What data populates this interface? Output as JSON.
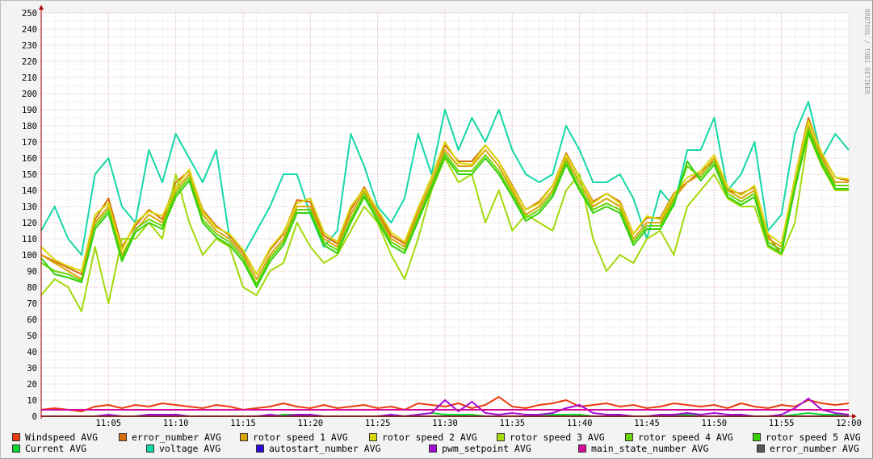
{
  "chart_data": {
    "type": "line",
    "watermark": "RRDTOOL / TOBI OETIKER",
    "ylim": [
      0,
      250
    ],
    "yticks": [
      0,
      10,
      20,
      30,
      40,
      50,
      60,
      70,
      80,
      90,
      100,
      110,
      120,
      130,
      140,
      150,
      160,
      170,
      180,
      190,
      200,
      210,
      220,
      230,
      240,
      250
    ],
    "x_minutes_range": [
      0,
      60
    ],
    "xticks": [
      {
        "m": 5,
        "label": "11:05"
      },
      {
        "m": 10,
        "label": "11:10"
      },
      {
        "m": 15,
        "label": "11:15"
      },
      {
        "m": 20,
        "label": "11:20"
      },
      {
        "m": 25,
        "label": "11:25"
      },
      {
        "m": 30,
        "label": "11:30"
      },
      {
        "m": 35,
        "label": "11:35"
      },
      {
        "m": 40,
        "label": "11:40"
      },
      {
        "m": 45,
        "label": "11:45"
      },
      {
        "m": 50,
        "label": "11:50"
      },
      {
        "m": 55,
        "label": "11:55"
      },
      {
        "m": 60,
        "label": "12:00"
      }
    ],
    "series": [
      {
        "name": "Windspeed AVG",
        "color": "#ea3c0c",
        "values": [
          4,
          5,
          4,
          3,
          6,
          7,
          5,
          7,
          6,
          8,
          7,
          6,
          5,
          7,
          6,
          4,
          5,
          6,
          8,
          6,
          5,
          7,
          5,
          6,
          7,
          5,
          6,
          4,
          8,
          7,
          6,
          8,
          5,
          7,
          12,
          6,
          5,
          7,
          8,
          10,
          6,
          7,
          8,
          6,
          7,
          5,
          6,
          8,
          7,
          6,
          7,
          5,
          8,
          6,
          5,
          7,
          6,
          10,
          8,
          7,
          8
        ]
      },
      {
        "name": "error_number AVG",
        "color": "#d76c0a",
        "values": [
          100,
          96,
          92,
          88,
          122,
          135,
          105,
          118,
          128,
          122,
          145,
          152,
          128,
          118,
          112,
          102,
          88,
          103,
          113,
          134,
          133,
          112,
          107,
          128,
          142,
          127,
          112,
          107,
          128,
          148,
          168,
          158,
          158,
          168,
          158,
          143,
          128,
          133,
          143,
          163,
          148,
          133,
          138,
          133,
          113,
          123,
          123,
          138,
          145,
          152,
          158,
          140,
          138,
          142,
          112,
          100,
          148,
          185,
          162,
          148,
          146
        ]
      },
      {
        "name": "rotor speed 1 AVG",
        "color": "#daa50a",
        "values": [
          100,
          95,
          90,
          85,
          120,
          130,
          100,
          115,
          125,
          120,
          140,
          150,
          125,
          115,
          110,
          100,
          85,
          100,
          110,
          130,
          130,
          110,
          105,
          125,
          140,
          125,
          110,
          105,
          125,
          145,
          165,
          155,
          155,
          165,
          155,
          140,
          125,
          130,
          140,
          160,
          145,
          130,
          135,
          130,
          110,
          120,
          120,
          135,
          145,
          150,
          160,
          140,
          135,
          140,
          110,
          105,
          145,
          180,
          160,
          145,
          145
        ]
      },
      {
        "name": "rotor speed 2 AVG",
        "color": "#d8d80a",
        "values": [
          105,
          97,
          93,
          90,
          125,
          132,
          103,
          120,
          127,
          124,
          142,
          153,
          127,
          117,
          113,
          103,
          88,
          104,
          114,
          132,
          135,
          114,
          108,
          130,
          141,
          128,
          114,
          108,
          129,
          148,
          170,
          157,
          156,
          168,
          158,
          142,
          128,
          132,
          143,
          162,
          148,
          132,
          138,
          132,
          113,
          124,
          122,
          137,
          148,
          152,
          162,
          142,
          137,
          143,
          113,
          107,
          148,
          183,
          163,
          148,
          147
        ]
      },
      {
        "name": "rotor speed 3 AVG",
        "color": "#a3d90a",
        "values": [
          75,
          85,
          80,
          65,
          105,
          70,
          110,
          110,
          120,
          110,
          150,
          120,
          100,
          110,
          105,
          80,
          75,
          90,
          95,
          120,
          105,
          95,
          100,
          115,
          130,
          120,
          100,
          85,
          110,
          140,
          160,
          145,
          150,
          120,
          140,
          115,
          125,
          120,
          115,
          140,
          150,
          110,
          90,
          100,
          95,
          110,
          115,
          100,
          130,
          140,
          150,
          135,
          130,
          130,
          105,
          100,
          120,
          175,
          155,
          140,
          140
        ]
      },
      {
        "name": "rotor speed 4 AVG",
        "color": "#6cd40a",
        "values": [
          95,
          90,
          88,
          84,
          118,
          128,
          98,
          116,
          122,
          118,
          138,
          148,
          122,
          113,
          108,
          98,
          82,
          98,
          108,
          128,
          128,
          108,
          103,
          122,
          138,
          123,
          108,
          103,
          123,
          143,
          163,
          152,
          152,
          162,
          152,
          138,
          123,
          128,
          138,
          158,
          142,
          128,
          132,
          128,
          108,
          118,
          118,
          133,
          155,
          148,
          158,
          138,
          133,
          138,
          108,
          103,
          143,
          178,
          158,
          143,
          143
        ]
      },
      {
        "name": "rotor speed 5 AVG",
        "color": "#34d10a",
        "values": [
          98,
          88,
          86,
          83,
          116,
          126,
          96,
          114,
          120,
          116,
          136,
          146,
          120,
          111,
          106,
          96,
          80,
          96,
          106,
          126,
          126,
          106,
          101,
          120,
          136,
          121,
          106,
          101,
          121,
          141,
          161,
          150,
          150,
          160,
          150,
          136,
          121,
          126,
          136,
          156,
          140,
          126,
          130,
          126,
          106,
          116,
          116,
          131,
          158,
          146,
          156,
          136,
          131,
          136,
          106,
          101,
          141,
          176,
          156,
          141,
          141
        ]
      },
      {
        "name": "Current AVG",
        "color": "#0ad634",
        "values": [
          0,
          0,
          0,
          0,
          0,
          0,
          0,
          0,
          1,
          1,
          1,
          0,
          0,
          0,
          0,
          0,
          0,
          0,
          1,
          1,
          0,
          0,
          0,
          0,
          0,
          0,
          0,
          0,
          1,
          2,
          1,
          1,
          1,
          0,
          0,
          0,
          0,
          0,
          1,
          1,
          1,
          0,
          0,
          0,
          0,
          0,
          0,
          1,
          1,
          0,
          0,
          0,
          0,
          0,
          0,
          0,
          1,
          2,
          1,
          1,
          1
        ]
      },
      {
        "name": "voltage AVG",
        "color": "#14d8a8",
        "values": [
          115,
          130,
          110,
          100,
          150,
          160,
          130,
          120,
          165,
          145,
          175,
          160,
          145,
          165,
          110,
          100,
          115,
          130,
          150,
          150,
          125,
          105,
          115,
          175,
          155,
          130,
          120,
          135,
          175,
          150,
          190,
          165,
          185,
          170,
          190,
          165,
          150,
          145,
          150,
          180,
          165,
          145,
          145,
          150,
          135,
          110,
          140,
          130,
          165,
          165,
          185,
          140,
          150,
          170,
          115,
          125,
          175,
          195,
          160,
          175,
          165
        ]
      },
      {
        "name": "autostart_number AVG",
        "color": "#2c0ad6",
        "values": [
          0,
          0,
          0,
          0,
          0,
          0,
          0,
          0,
          0,
          0,
          0,
          0,
          0,
          0,
          0,
          0,
          0,
          0,
          0,
          0,
          0,
          0,
          0,
          0,
          0,
          0,
          0,
          0,
          0,
          0,
          0,
          0,
          0,
          0,
          0,
          0,
          0,
          0,
          0,
          0,
          0,
          0,
          0,
          0,
          0,
          0,
          0,
          0,
          0,
          0,
          0,
          0,
          0,
          0,
          0,
          0,
          0,
          0,
          0,
          0,
          0
        ]
      },
      {
        "name": "pwm_setpoint AVG",
        "color": "#a40ad6",
        "values": [
          0,
          0,
          0,
          0,
          0,
          1,
          0,
          0,
          1,
          1,
          1,
          0,
          0,
          0,
          0,
          0,
          0,
          1,
          0,
          1,
          1,
          0,
          0,
          0,
          0,
          0,
          1,
          0,
          1,
          2,
          10,
          3,
          9,
          2,
          1,
          2,
          1,
          1,
          2,
          5,
          7,
          2,
          1,
          1,
          0,
          0,
          1,
          1,
          2,
          1,
          2,
          1,
          1,
          0,
          0,
          1,
          5,
          11,
          4,
          2,
          1
        ]
      },
      {
        "name": "main_state_number AVG",
        "color": "#d60a98",
        "values": [
          4,
          4,
          4,
          4,
          4,
          4,
          4,
          4,
          4,
          4,
          4,
          4,
          4,
          4,
          4,
          4,
          4,
          4,
          4,
          4,
          4,
          4,
          4,
          4,
          4,
          4,
          4,
          4,
          4,
          4,
          4,
          4,
          4,
          4,
          4,
          4,
          4,
          4,
          4,
          4,
          4,
          4,
          4,
          4,
          4,
          4,
          4,
          4,
          4,
          4,
          4,
          4,
          4,
          4,
          4,
          4,
          4,
          4,
          4,
          4,
          4
        ]
      },
      {
        "name": "error_number AVG",
        "color": "#555555",
        "values": [
          0,
          0,
          0,
          0,
          0,
          0,
          0,
          0,
          0,
          0,
          0,
          0,
          0,
          0,
          0,
          0,
          0,
          0,
          0,
          0,
          0,
          0,
          0,
          0,
          0,
          0,
          0,
          0,
          0,
          0,
          0,
          0,
          0,
          0,
          0,
          0,
          0,
          0,
          0,
          0,
          0,
          0,
          0,
          0,
          0,
          0,
          0,
          0,
          0,
          0,
          0,
          0,
          0,
          0,
          0,
          0,
          0,
          0,
          0,
          0,
          0
        ]
      }
    ]
  }
}
